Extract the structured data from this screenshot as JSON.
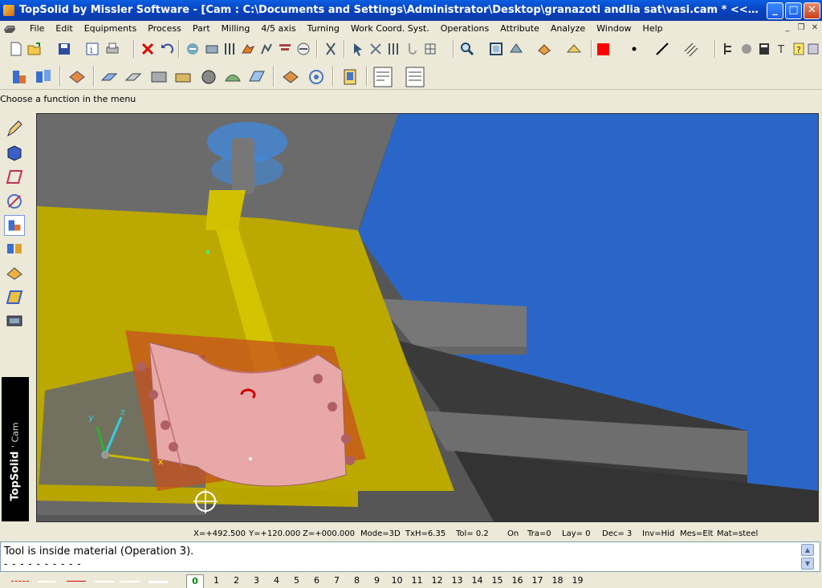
{
  "window": {
    "title": "TopSolid by Missler Software - [Cam : C:\\Documents and Settings\\Administrator\\Desktop\\granazoti andlia sat\\vasi.cam *  <<current>> (Associative ...",
    "minimize": "_",
    "maximize": "□",
    "close": "✕"
  },
  "menu": {
    "items": [
      "File",
      "Edit",
      "Equipments",
      "Process",
      "Part",
      "Milling",
      "4/5 axis",
      "Turning",
      "Work Coord. Syst.",
      "Operations",
      "Attribute",
      "Analyze",
      "Window",
      "Help"
    ],
    "mdi_min": "_",
    "mdi_restore": "❐",
    "mdi_close": "✕"
  },
  "prompt": "Choose a function in the menu",
  "brand": {
    "name": "TopSolid",
    "module": "' Cam"
  },
  "status": {
    "x": "X=+492.500",
    "y": "Y=+120.000",
    "z": "Z=+000.000",
    "mode": "Mode=3D",
    "txh": "TxH=6.35",
    "tol": "Tol=  0.2",
    "on": "On",
    "tra": "Tra=0",
    "lay": "Lay=  0",
    "dec": "Dec= 3",
    "inv": "Inv=Hid",
    "mes": "Mes=Elt",
    "mat": "Mat=steel"
  },
  "message": {
    "line1": "Tool is inside material (Operation 3).",
    "line2": "- - - - - - - - - -"
  },
  "layers": {
    "current": "0",
    "items": [
      "1",
      "2",
      "3",
      "4",
      "5",
      "6",
      "7",
      "8",
      "9",
      "10",
      "11",
      "12",
      "13",
      "14",
      "15",
      "16",
      "17",
      "18",
      "19"
    ]
  },
  "axes": {
    "x": "x",
    "y": "y",
    "z": "z"
  },
  "colors": {
    "title_bar": "#0842c0",
    "viewport_blue": "#1e5cbf",
    "machine_yellow": "#c9b600",
    "part_pink": "#e8a8a8",
    "fixture_orange": "#d2541e",
    "color_swatch": "#ff0000"
  },
  "toolbar_icons": [
    "new-file-icon",
    "open-file-icon",
    "save-icon",
    "properties-icon",
    "print-icon",
    "delete-icon",
    "undo-icon",
    "zoom-icon",
    "zoom-window-icon",
    "color-swatch"
  ]
}
